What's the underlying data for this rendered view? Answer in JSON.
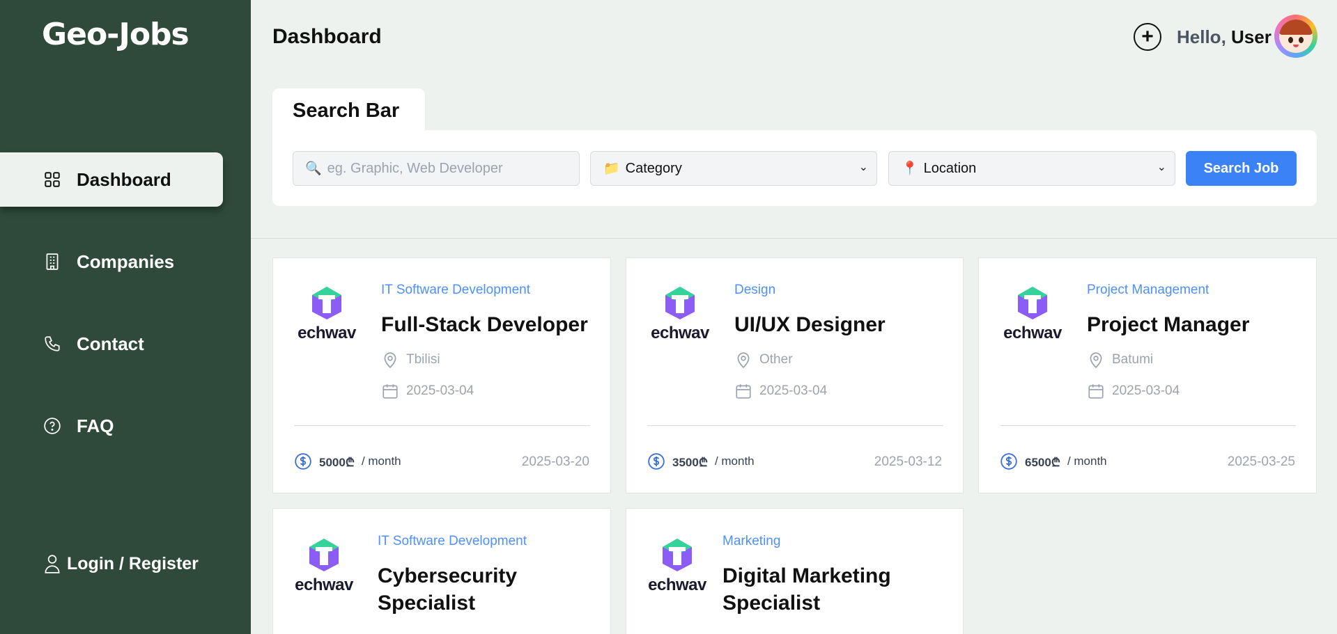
{
  "brand": "Geo-Jobs",
  "sidebar": {
    "items": [
      {
        "label": "Dashboard",
        "icon": "grid-icon"
      },
      {
        "label": "Companies",
        "icon": "building-icon"
      },
      {
        "label": "Contact",
        "icon": "phone-icon"
      },
      {
        "label": "FAQ",
        "icon": "question-circle-icon"
      }
    ],
    "login_label": "Login / Register"
  },
  "header": {
    "title": "Dashboard",
    "greeting": "Hello,",
    "user_name": "User"
  },
  "search": {
    "tab_label": "Search Bar",
    "placeholder": "eg. Graphic, Web Developer",
    "category_label": "Category",
    "location_label": "Location",
    "button_label": "Search Job"
  },
  "jobs": [
    {
      "logo_text": "echwav",
      "category": "IT Software Development",
      "title": "Full-Stack Developer",
      "location": "Tbilisi",
      "posted": "2025-03-04",
      "salary": "5000₾",
      "period": "/ month",
      "deadline": "2025-03-20"
    },
    {
      "logo_text": "echwav",
      "category": "Design",
      "title": "UI/UX Designer",
      "location": "Other",
      "posted": "2025-03-04",
      "salary": "3500₾",
      "period": "/ month",
      "deadline": "2025-03-12"
    },
    {
      "logo_text": "echwav",
      "category": "Project Management",
      "title": "Project Manager",
      "location": "Batumi",
      "posted": "2025-03-04",
      "salary": "6500₾",
      "period": "/ month",
      "deadline": "2025-03-25"
    },
    {
      "logo_text": "echwav",
      "category": "IT Software Development",
      "title_line1": "Cybersecurity",
      "title_line2": "Specialist"
    },
    {
      "logo_text": "echwav",
      "category": "Marketing",
      "title_line1": "Digital Marketing",
      "title_line2": "Specialist"
    }
  ],
  "colors": {
    "sidebar": "#2f4a3a",
    "background": "#edf2ef",
    "accent": "#3b82f6",
    "category_text": "#4d90fe"
  }
}
